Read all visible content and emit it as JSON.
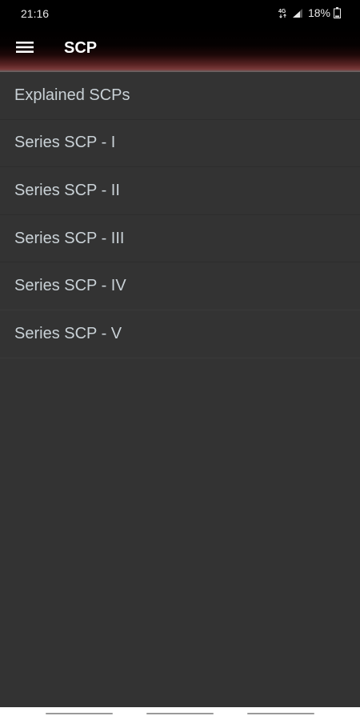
{
  "status_bar": {
    "time": "21:16",
    "network_label": "4G",
    "battery_percent": "18%",
    "icons": [
      "network-4g-icon",
      "signal-icon",
      "battery-icon"
    ]
  },
  "app_bar": {
    "title": "SCP",
    "menu_icon": "hamburger-menu-icon"
  },
  "list": {
    "items": [
      {
        "label": "Explained SCPs"
      },
      {
        "label": "Series SCP - I"
      },
      {
        "label": "Series SCP - II"
      },
      {
        "label": "Series SCP - III"
      },
      {
        "label": "Series SCP - IV"
      },
      {
        "label": "Series SCP - V"
      }
    ]
  },
  "colors": {
    "background": "#333333",
    "status_bar": "#000000",
    "app_bar_accent": "#7a3a3a",
    "list_text": "#c9d1d6",
    "title_text": "#ffffff"
  }
}
